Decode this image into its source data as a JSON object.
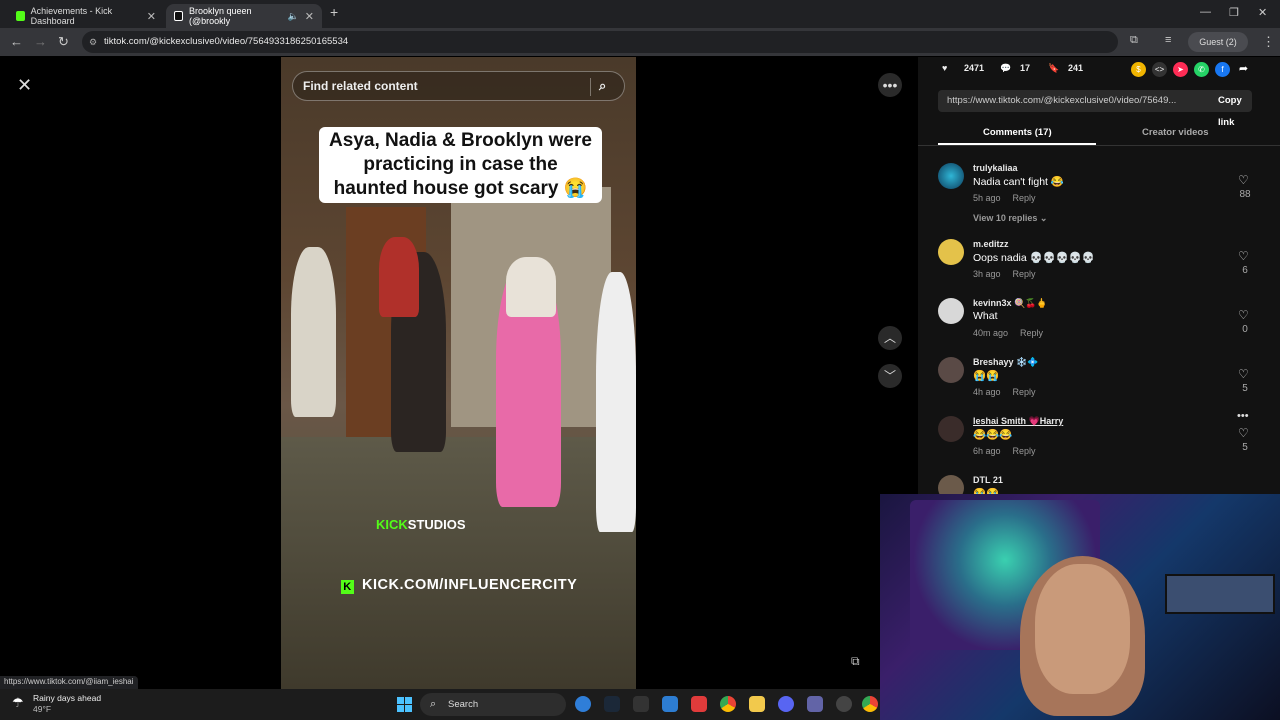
{
  "browser": {
    "tabs": [
      {
        "label": "Achievements - Kick Dashboard",
        "active": false
      },
      {
        "label": "Brooklyn queen (@brookly",
        "active": true
      }
    ],
    "url": "tiktok.com/@kickexclusive0/video/7564933186250165534",
    "profile_label": "Guest (2)"
  },
  "video": {
    "search_placeholder": "Find related content",
    "caption": "Asya, Nadia & Brooklyn were practicing in case the haunted house got scary 😭",
    "kick_studios_green": "KICK",
    "kick_studios_rest": "STUDIOS",
    "kick_url": "KICK.COM/INFLUENCERCITY"
  },
  "stats": {
    "likes": "2471",
    "comments": "17",
    "saves": "241"
  },
  "share": {
    "link": "https://www.tiktok.com/@kickexclusive0/video/75649...",
    "copy_label": "Copy link"
  },
  "panel_tabs": {
    "comments": "Comments (17)",
    "creator": "Creator videos"
  },
  "comments": [
    {
      "user": "trulykaliaa",
      "text": "Nadia can't fight 😂",
      "time": "5h ago",
      "reply": "Reply",
      "likes": "88"
    },
    {
      "user": "m.editzz",
      "text": "Oops nadia 💀💀💀💀💀",
      "time": "3h ago",
      "reply": "Reply",
      "likes": "6"
    },
    {
      "user": "kevinn3x 🍭🍒🖕",
      "text": "What",
      "time": "40m ago",
      "reply": "Reply",
      "likes": "0"
    },
    {
      "user": "Breshayy ❄️💠",
      "text": "😭😭",
      "time": "4h ago",
      "reply": "Reply",
      "likes": "5"
    },
    {
      "user": "Ieshai Smith 💗Harry",
      "text": "😂😂😂",
      "time": "6h ago",
      "reply": "Reply",
      "likes": "5"
    },
    {
      "user": "DTL 21",
      "text": "😭😭",
      "time": "",
      "reply": "",
      "likes": ""
    }
  ],
  "view_replies": "View 10 replies ⌄",
  "status_url": "https://www.tiktok.com/@iiam_ieshai",
  "taskbar": {
    "weather_title": "Rainy days ahead",
    "weather_temp": "49°F",
    "search_label": "Search"
  }
}
